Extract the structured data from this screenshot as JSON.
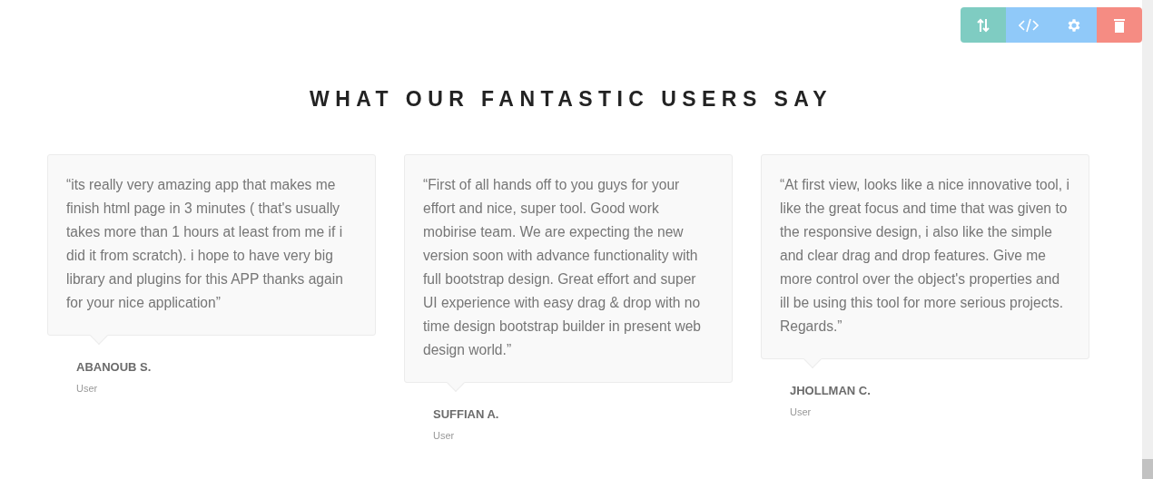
{
  "toolbar": [
    {
      "kind": "move",
      "color": "#7fccc2"
    },
    {
      "kind": "code",
      "color": "#90c9f9"
    },
    {
      "kind": "settings",
      "color": "#90c9f9"
    },
    {
      "kind": "delete",
      "color": "#f58c83"
    }
  ],
  "heading": "WHAT OUR FANTASTIC USERS SAY",
  "testimonials": [
    {
      "quote": "“its really very amazing app that makes me finish html page in 3 minutes ( that's usually takes more than 1 hours at least from me if i did it from scratch). i hope to have very big library and plugins for this APP thanks again for your nice application”",
      "name": "ABANOUB S.",
      "role": "User"
    },
    {
      "quote": "“First of all hands off to you guys for your effort and nice, super tool. Good work mobirise team. We are expecting the new version soon with advance functionality with full bootstrap design. Great effort and super UI experience with easy drag & drop with no time design bootstrap builder in present web design world.”",
      "name": "SUFFIAN A.",
      "role": "User"
    },
    {
      "quote": "“At first view, looks like a nice innovative tool, i like the great focus and time that was given to the responsive design, i also like the simple and clear drag and drop features. Give me more control over the object's properties and ill be using this tool for more serious projects. Regards.”",
      "name": "JHOLLMAN C.",
      "role": "User"
    }
  ]
}
